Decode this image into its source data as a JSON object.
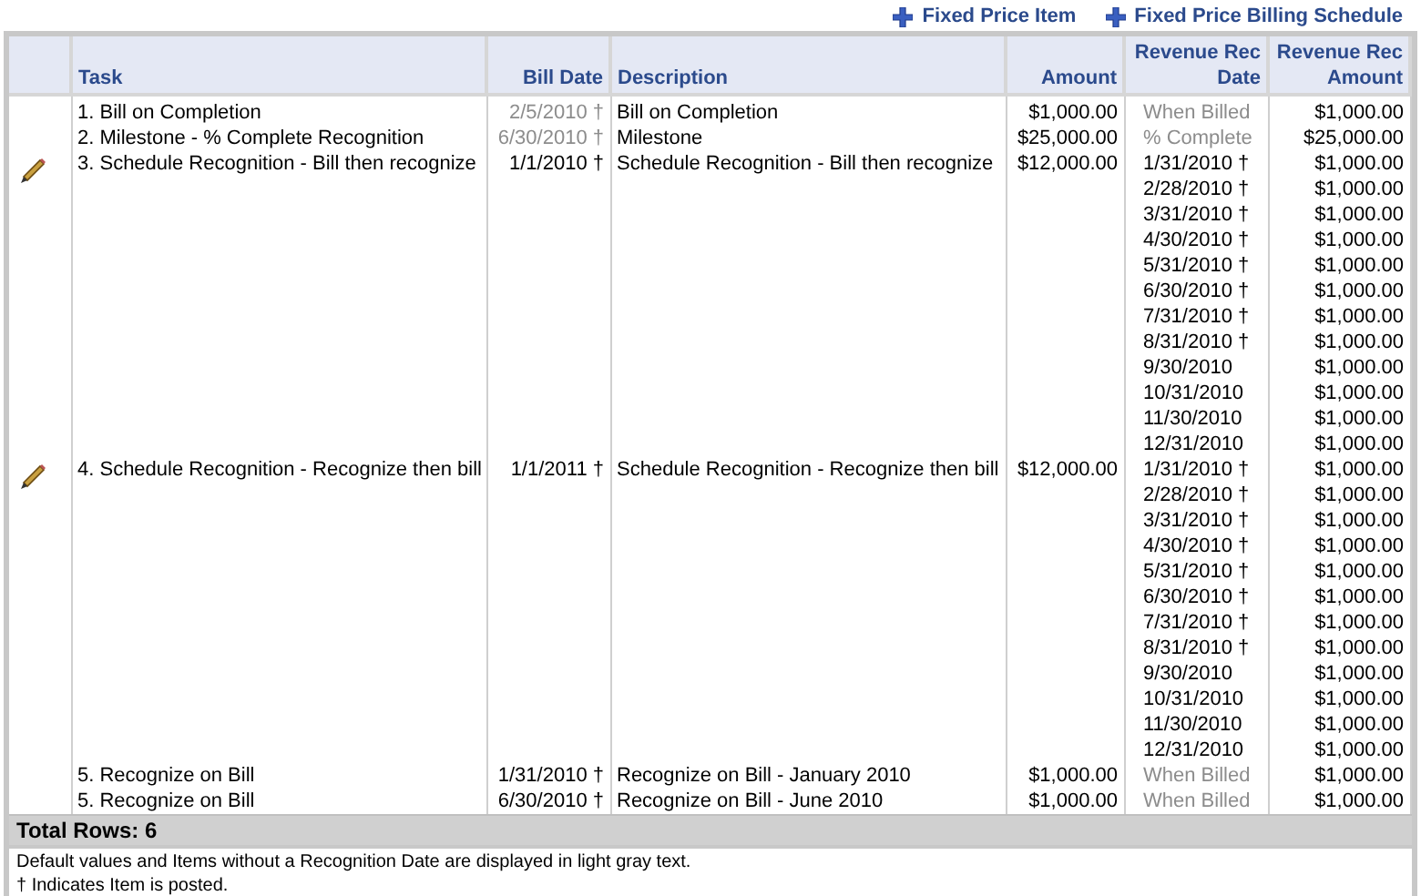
{
  "actions": [
    {
      "label": "Fixed Price Item"
    },
    {
      "label": "Fixed Price Billing Schedule"
    }
  ],
  "columns": [
    {
      "label": "Task"
    },
    {
      "label": "Bill Date"
    },
    {
      "label": "Description"
    },
    {
      "label": "Amount"
    },
    {
      "label": "Revenue Rec Date"
    },
    {
      "label": "Revenue Rec Amount"
    }
  ],
  "rows": [
    {
      "editable": false,
      "task": "1. Bill on Completion",
      "bill_date": "2/5/2010 †",
      "bill_date_default": true,
      "description": "Bill on Completion",
      "amount": "$1,000.00",
      "schedule": [
        {
          "date": "When Billed",
          "default": true,
          "amount": "$1,000.00"
        }
      ]
    },
    {
      "editable": false,
      "task": "2. Milestone - % Complete Recognition",
      "bill_date": "6/30/2010 †",
      "bill_date_default": true,
      "description": "Milestone",
      "amount": "$25,000.00",
      "schedule": [
        {
          "date": "% Complete",
          "default": true,
          "amount": "$25,000.00"
        }
      ]
    },
    {
      "editable": true,
      "task": "3. Schedule Recognition - Bill then recognize",
      "bill_date": "1/1/2010 †",
      "bill_date_default": false,
      "description": "Schedule Recognition - Bill then recognize",
      "amount": "$12,000.00",
      "schedule": [
        {
          "date": "1/31/2010 †",
          "default": false,
          "amount": "$1,000.00"
        },
        {
          "date": "2/28/2010 †",
          "default": false,
          "amount": "$1,000.00"
        },
        {
          "date": "3/31/2010 †",
          "default": false,
          "amount": "$1,000.00"
        },
        {
          "date": "4/30/2010 †",
          "default": false,
          "amount": "$1,000.00"
        },
        {
          "date": "5/31/2010 †",
          "default": false,
          "amount": "$1,000.00"
        },
        {
          "date": "6/30/2010 †",
          "default": false,
          "amount": "$1,000.00"
        },
        {
          "date": "7/31/2010 †",
          "default": false,
          "amount": "$1,000.00"
        },
        {
          "date": "8/31/2010 †",
          "default": false,
          "amount": "$1,000.00"
        },
        {
          "date": "9/30/2010",
          "default": false,
          "amount": "$1,000.00"
        },
        {
          "date": "10/31/2010",
          "default": false,
          "amount": "$1,000.00"
        },
        {
          "date": "11/30/2010",
          "default": false,
          "amount": "$1,000.00"
        },
        {
          "date": "12/31/2010",
          "default": false,
          "amount": "$1,000.00"
        }
      ]
    },
    {
      "editable": true,
      "task": "4. Schedule Recognition - Recognize then bill",
      "bill_date": "1/1/2011 †",
      "bill_date_default": false,
      "description": "Schedule Recognition - Recognize then bill",
      "amount": "$12,000.00",
      "schedule": [
        {
          "date": "1/31/2010 †",
          "default": false,
          "amount": "$1,000.00"
        },
        {
          "date": "2/28/2010 †",
          "default": false,
          "amount": "$1,000.00"
        },
        {
          "date": "3/31/2010 †",
          "default": false,
          "amount": "$1,000.00"
        },
        {
          "date": "4/30/2010 †",
          "default": false,
          "amount": "$1,000.00"
        },
        {
          "date": "5/31/2010 †",
          "default": false,
          "amount": "$1,000.00"
        },
        {
          "date": "6/30/2010 †",
          "default": false,
          "amount": "$1,000.00"
        },
        {
          "date": "7/31/2010 †",
          "default": false,
          "amount": "$1,000.00"
        },
        {
          "date": "8/31/2010 †",
          "default": false,
          "amount": "$1,000.00"
        },
        {
          "date": "9/30/2010",
          "default": false,
          "amount": "$1,000.00"
        },
        {
          "date": "10/31/2010",
          "default": false,
          "amount": "$1,000.00"
        },
        {
          "date": "11/30/2010",
          "default": false,
          "amount": "$1,000.00"
        },
        {
          "date": "12/31/2010",
          "default": false,
          "amount": "$1,000.00"
        }
      ]
    },
    {
      "editable": false,
      "task": "5. Recognize on Bill",
      "bill_date": "1/31/2010 †",
      "bill_date_default": false,
      "description": "Recognize on Bill - January 2010",
      "amount": "$1,000.00",
      "schedule": [
        {
          "date": "When Billed",
          "default": true,
          "amount": "$1,000.00"
        }
      ]
    },
    {
      "editable": false,
      "task": "5. Recognize on Bill",
      "bill_date": "6/30/2010 †",
      "bill_date_default": false,
      "description": "Recognize on Bill - June 2010",
      "amount": "$1,000.00",
      "schedule": [
        {
          "date": "When Billed",
          "default": true,
          "amount": "$1,000.00"
        }
      ]
    }
  ],
  "total": "Total Rows: 6",
  "notes": [
    "Default values and Items without a Recognition Date are displayed in light gray text.",
    "† Indicates Item is posted."
  ]
}
